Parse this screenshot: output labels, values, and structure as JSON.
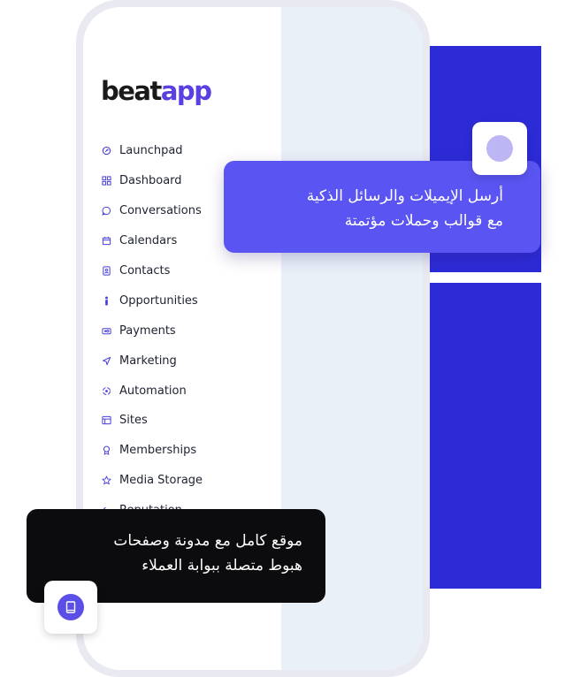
{
  "logo": {
    "part1": "beat",
    "part2": "app"
  },
  "sidebar": {
    "items": [
      {
        "label": "Launchpad",
        "icon": "rocket-icon"
      },
      {
        "label": "Dashboard",
        "icon": "grid-icon"
      },
      {
        "label": "Conversations",
        "icon": "chat-icon"
      },
      {
        "label": "Calendars",
        "icon": "calendar-icon"
      },
      {
        "label": "Contacts",
        "icon": "contact-icon"
      },
      {
        "label": "Opportunities",
        "icon": "person-icon"
      },
      {
        "label": "Payments",
        "icon": "payment-icon"
      },
      {
        "label": "Marketing",
        "icon": "send-icon"
      },
      {
        "label": "Automation",
        "icon": "automation-icon"
      },
      {
        "label": "Sites",
        "icon": "sites-icon"
      },
      {
        "label": "Memberships",
        "icon": "badge-icon"
      },
      {
        "label": "Media Storage",
        "icon": "star-icon"
      },
      {
        "label": "Reputation",
        "icon": "reply-icon"
      }
    ]
  },
  "callout_email": {
    "line1": "أرسل الإيميلات والرسائل الذكية",
    "line2": "مع قوالب وحملات مؤتمتة"
  },
  "callout_site": {
    "line1": "موقع كامل مع مدونة وصفحات",
    "line2": "هبوط متصلة ببوابة العملاء"
  },
  "colors": {
    "accent": "#5a55f2",
    "brand_blue": "#2d2bd6",
    "icon": "#4a40d8",
    "dark_card": "#0c0c0e"
  }
}
